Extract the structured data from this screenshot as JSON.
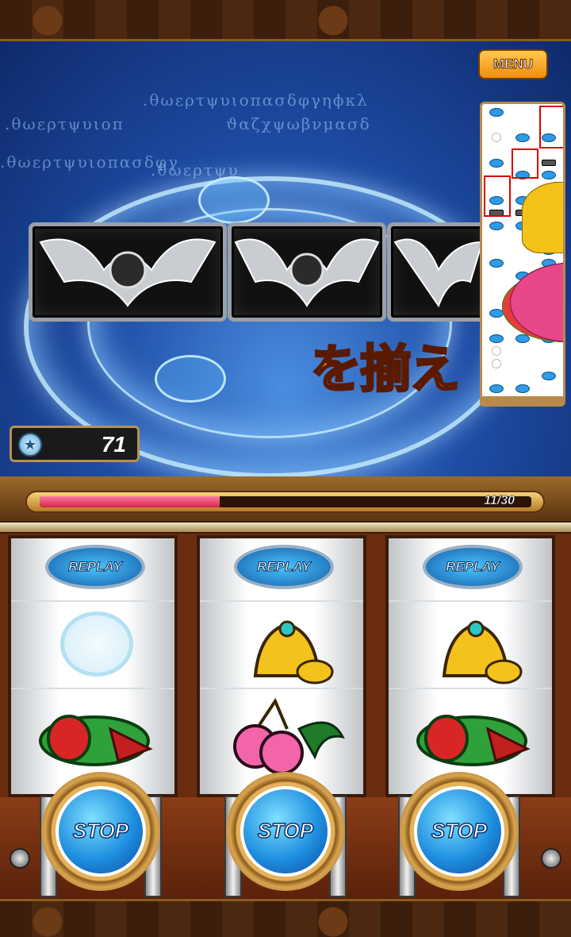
{
  "header": {
    "menu_label": "MENU"
  },
  "stage": {
    "banner_text": "を揃え",
    "rune_lines": [
      ".θωερτψυιοπ",
      ".θωερτψυιοπασδφγηϕκλ",
      ".θωερτψυιοπασδφγ",
      "ϑαζχψωβνμασδ",
      ".θωερτψυ"
    ]
  },
  "reel_strip": {
    "rows": [
      [
        "replay",
        "cherry",
        "bell"
      ],
      [
        "melon",
        "melon",
        "cherry"
      ],
      [
        "blank",
        "replay",
        "replay"
      ],
      [
        "bell",
        "bell",
        "cherry"
      ],
      [
        "replay",
        "cherry",
        "bar"
      ],
      [
        "melon",
        "replay",
        "replay"
      ],
      [
        "bell",
        "bell",
        "replay"
      ],
      [
        "replay",
        "replay",
        "cherry"
      ],
      [
        "bar",
        "bar",
        "melon"
      ],
      [
        "replay",
        "replay",
        "bell"
      ],
      [
        "cherry",
        "bell",
        "cherry"
      ],
      [
        "bell",
        "cherry",
        "replay"
      ],
      [
        "replay",
        "bell",
        "replay"
      ],
      [
        "bell",
        "replay",
        "bell"
      ],
      [
        "melon",
        "melon",
        "melon"
      ],
      [
        "bell",
        "replay",
        "bell"
      ],
      [
        "replay",
        "bell",
        "replay"
      ],
      [
        "cherry",
        "bell",
        "cherry"
      ],
      [
        "replay",
        "replay",
        "replay"
      ],
      [
        "blank",
        "bell",
        "bell"
      ],
      [
        "blank",
        "melon",
        "cherry"
      ],
      [
        "bell",
        "bell",
        "replay"
      ],
      [
        "replay",
        "replay",
        "cherry"
      ]
    ]
  },
  "coins": {
    "value": "71"
  },
  "gauge": {
    "text": "11/30",
    "current": 11,
    "max": 30
  },
  "reels": [
    {
      "replay_label": "REPLAY",
      "middle": "blank",
      "bottom": "melon"
    },
    {
      "replay_label": "REPLAY",
      "middle": "bell",
      "bottom": "cherry"
    },
    {
      "replay_label": "REPLAY",
      "middle": "bell",
      "bottom": "melon"
    }
  ],
  "stop_buttons": [
    "STOP",
    "STOP",
    "STOP"
  ],
  "colors": {
    "accent": "#f08d10",
    "gauge_fill": "#d4244a",
    "stop_blue": "#1f8fe0"
  }
}
